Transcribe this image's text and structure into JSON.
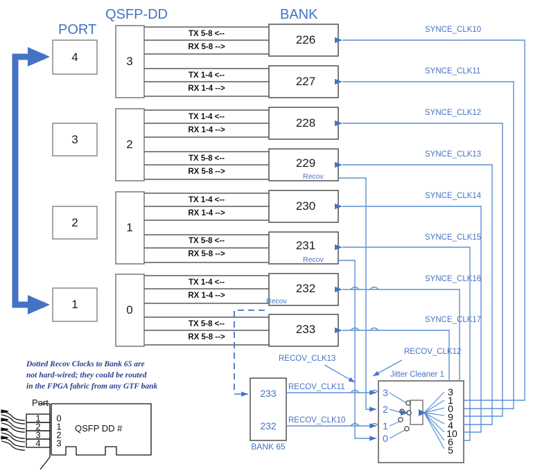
{
  "headers": {
    "port": "PORT",
    "qsfp_dd": "QSFP-DD",
    "bank": "BANK"
  },
  "ports": [
    {
      "label": "4"
    },
    {
      "label": "3"
    },
    {
      "label": "2"
    },
    {
      "label": "1"
    }
  ],
  "qsfp_modules": [
    {
      "label": "3"
    },
    {
      "label": "2"
    },
    {
      "label": "1"
    },
    {
      "label": "0"
    }
  ],
  "banks": [
    {
      "label": "226",
      "tx": "TX 5-8 <--",
      "rx": "RX 5-8 -->",
      "recov": "",
      "synce": "SYNCE_CLK10"
    },
    {
      "label": "227",
      "tx": "TX 1-4 <--",
      "rx": "RX 1-4 -->",
      "recov": "",
      "synce": "SYNCE_CLK11"
    },
    {
      "label": "228",
      "tx": "TX 1-4 <--",
      "rx": "RX 1-4 -->",
      "recov": "",
      "synce": "SYNCE_CLK12"
    },
    {
      "label": "229",
      "tx": "TX 5-8 <--",
      "rx": "RX 5-8 -->",
      "recov": "Recov",
      "synce": "SYNCE_CLK13"
    },
    {
      "label": "230",
      "tx": "TX 1-4 <--",
      "rx": "RX 1-4 -->",
      "recov": "",
      "synce": "SYNCE_CLK14"
    },
    {
      "label": "231",
      "tx": "TX 5-8 <--",
      "rx": "RX 5-8 -->",
      "recov": "Recov",
      "synce": "SYNCE_CLK15"
    },
    {
      "label": "232",
      "tx": "TX 1-4 <--",
      "rx": "RX 1-4 -->",
      "recov": "Recov",
      "synce": "SYNCE_CLK16"
    },
    {
      "label": "233",
      "tx": "TX 5-8 <--",
      "rx": "RX 5-8 -->",
      "recov": "",
      "synce": "SYNCE_CLK17"
    }
  ],
  "note": {
    "line1": "Dotted Recov Clocks to Bank 65 are",
    "line2": "not hard-wired; they could be routed",
    "line3": "in the FPGA fabric from any GTF bank"
  },
  "bank65": {
    "title": "BANK 65",
    "rows": [
      {
        "num": "233",
        "clk": "RECOV_CLK11"
      },
      {
        "num": "232",
        "clk": "RECOV_CLK10"
      }
    ]
  },
  "recov_clk_labels": {
    "clk13": "RECOV_CLK13",
    "clk12": "RECOV_CLK12"
  },
  "jitter_cleaner": {
    "title": "Jitter Cleaner 1",
    "inputs": [
      "3",
      "2",
      "1",
      "0"
    ],
    "outputs": [
      "3",
      "1",
      "0",
      "9",
      "4",
      "10",
      "6",
      "5"
    ]
  },
  "connector": {
    "port_label": "Port",
    "body_label": "QSFP DD #",
    "port_numbers": [
      "1",
      "2",
      "3",
      "4"
    ],
    "module_numbers": [
      "0",
      "1",
      "2",
      "3"
    ]
  },
  "colors": {
    "accent_blue": "#4472C4",
    "line_blue": "#5B8FD4",
    "box_border": "#7F7F7F",
    "dark_text": "#1a1a1a"
  }
}
